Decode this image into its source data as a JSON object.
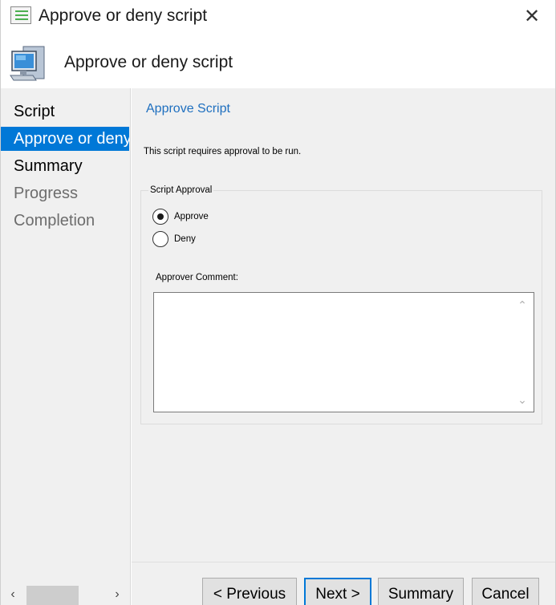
{
  "window": {
    "title": "Approve or deny script",
    "close_glyph": "✕"
  },
  "header": {
    "title": "Approve or deny script",
    "icon": "computer-icon"
  },
  "sidebar": {
    "items": [
      {
        "label": "Script",
        "state": "normal"
      },
      {
        "label": "Approve or deny script",
        "state": "active"
      },
      {
        "label": "Summary",
        "state": "normal"
      },
      {
        "label": "Progress",
        "state": "disabled"
      },
      {
        "label": "Completion",
        "state": "disabled"
      }
    ],
    "scroll_left": "‹",
    "scroll_right": "›"
  },
  "main": {
    "heading": "Approve Script",
    "description": "This script requires approval to be run.",
    "group_label": "Script Approval",
    "options": [
      {
        "label": "Approve",
        "checked": true
      },
      {
        "label": "Deny",
        "checked": false
      }
    ],
    "comment_label": "Approver Comment:",
    "comment_value": "",
    "scroll_up": "⌃",
    "scroll_down": "⌄"
  },
  "buttons": {
    "previous": "< Previous",
    "next": "Next >",
    "summary": "Summary",
    "cancel": "Cancel"
  },
  "colors": {
    "accent": "#0078d7",
    "heading": "#1e6fbf",
    "panel": "#f0f0f0"
  }
}
